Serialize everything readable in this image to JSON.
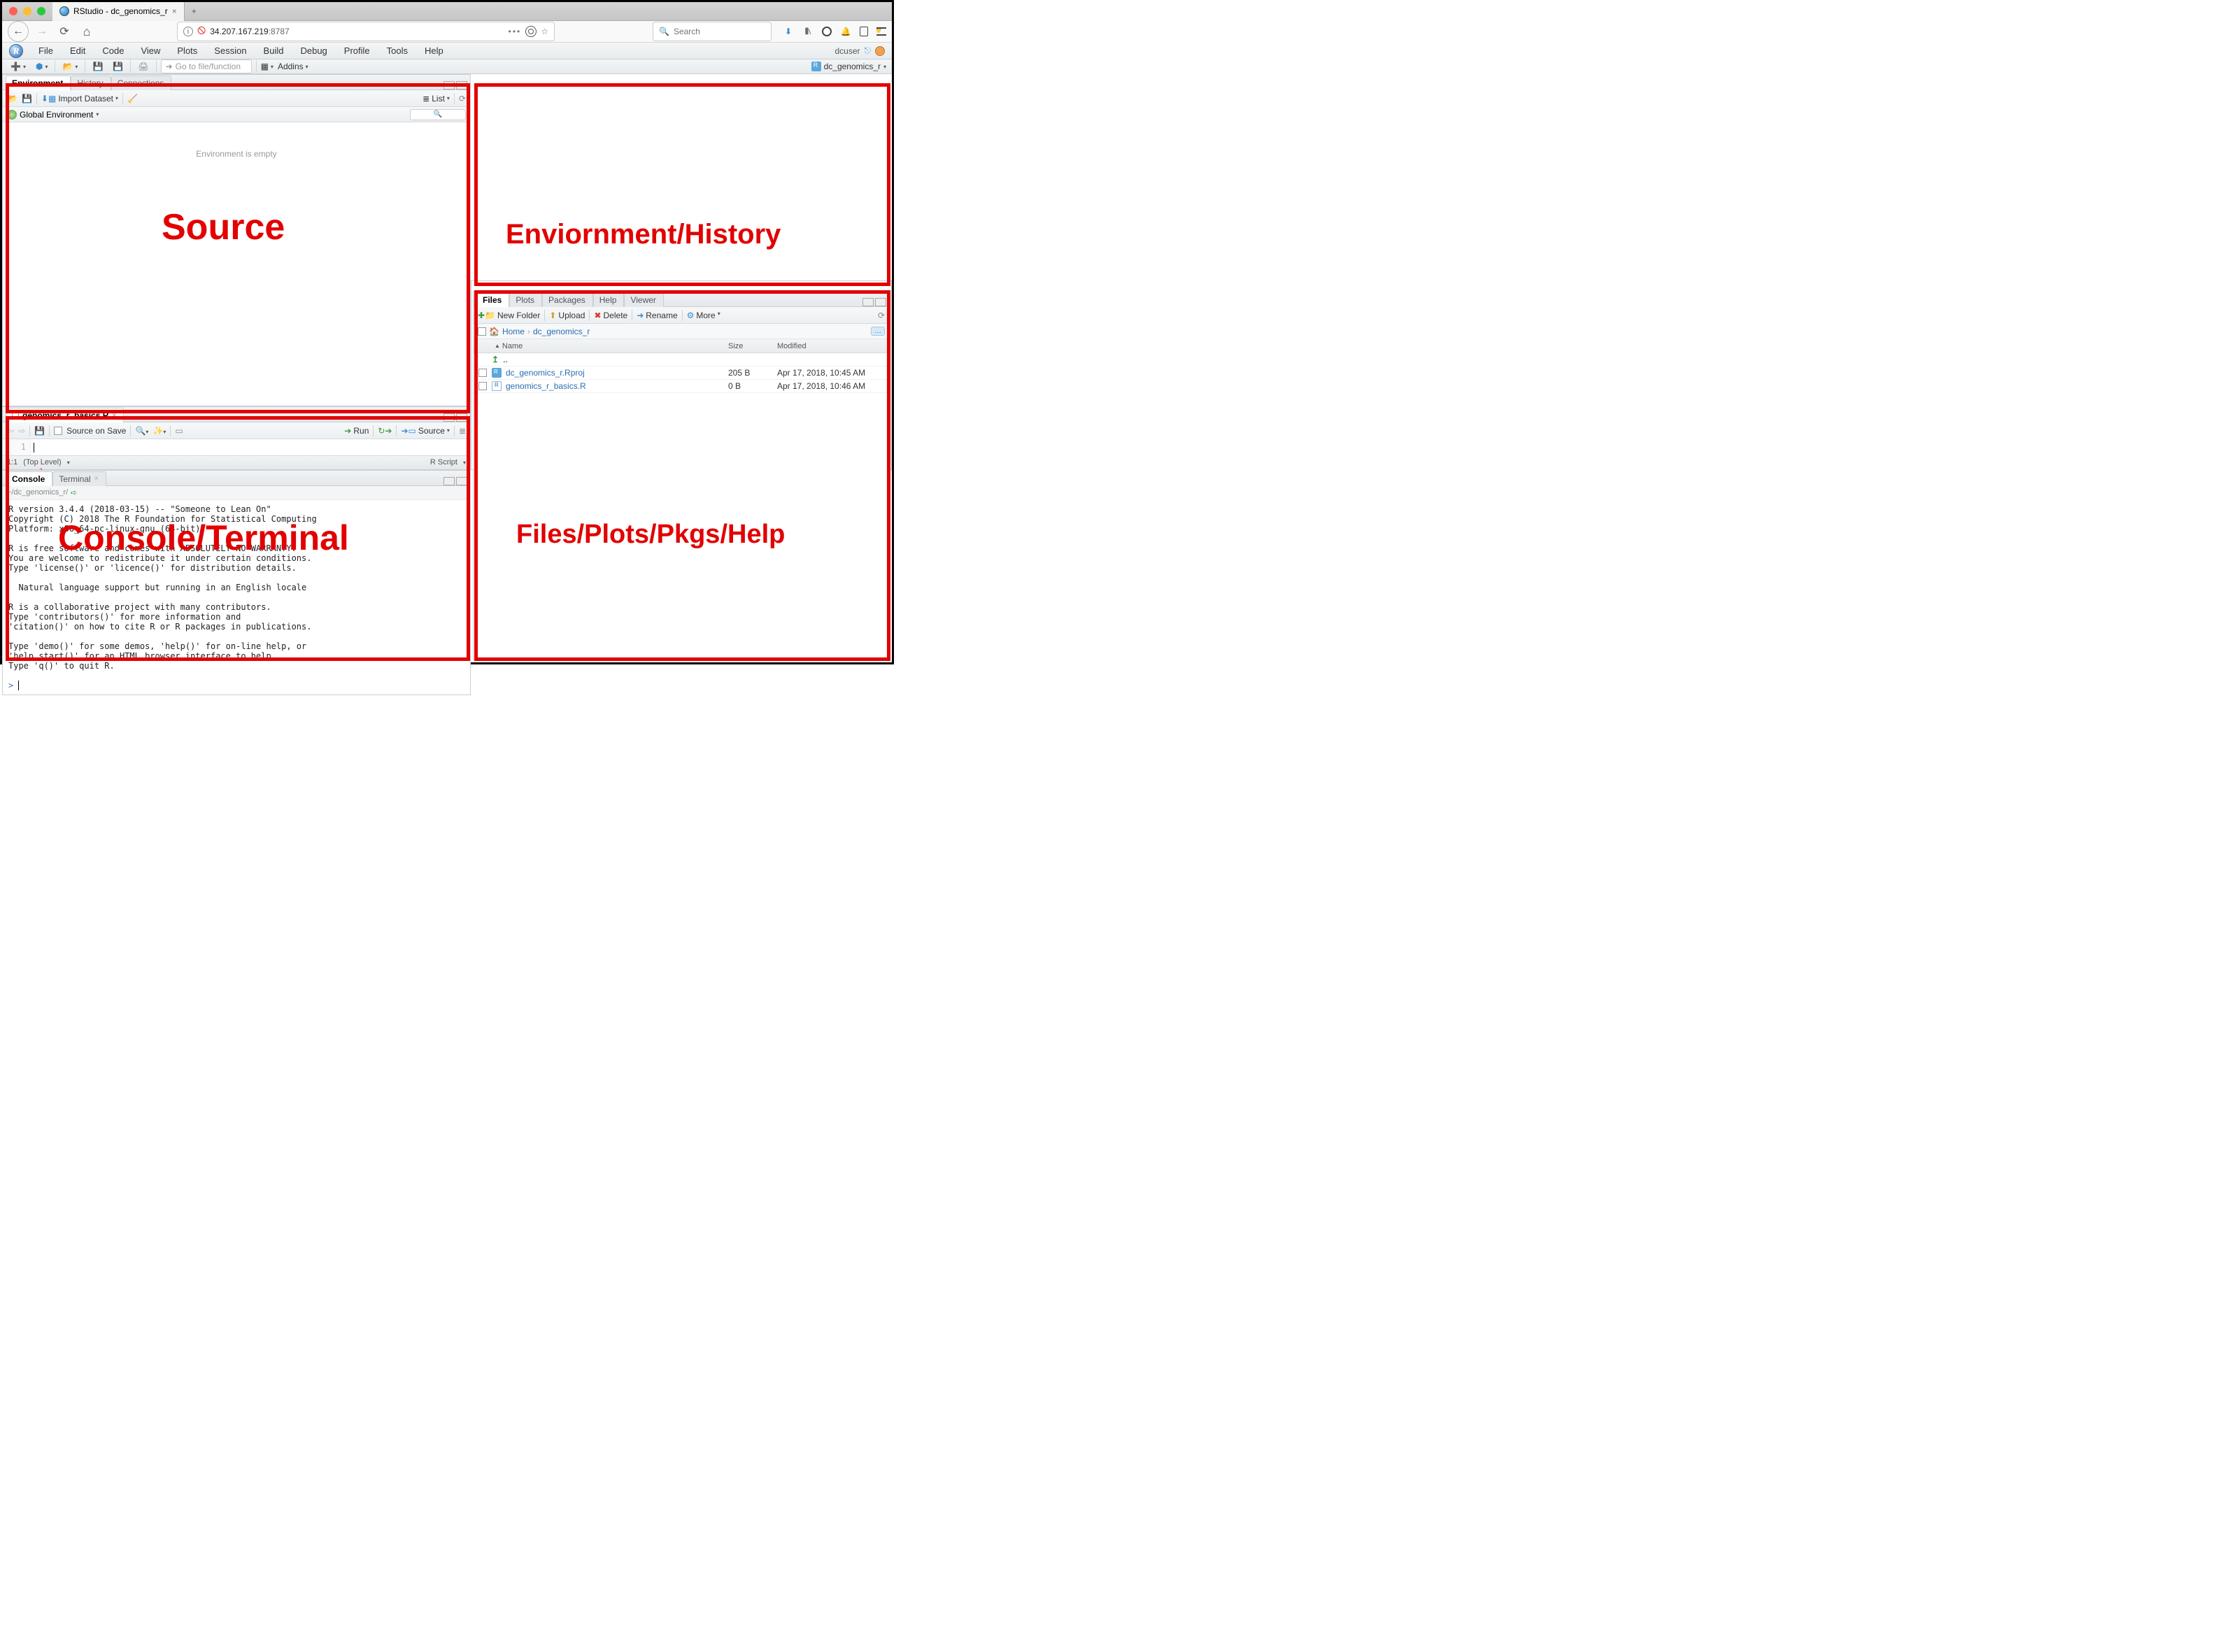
{
  "browser": {
    "tab_title": "RStudio - dc_genomics_r",
    "url_host": "34.207.167.219",
    "url_port": ":8787",
    "search_placeholder": "Search"
  },
  "menubar": {
    "items": [
      "File",
      "Edit",
      "Code",
      "View",
      "Plots",
      "Session",
      "Build",
      "Debug",
      "Profile",
      "Tools",
      "Help"
    ],
    "user": "dcuser",
    "project": "dc_genomics_r"
  },
  "toolbar": {
    "goto_placeholder": "Go to file/function",
    "addins_label": "Addins"
  },
  "source": {
    "tab": "genomics_r_basics.R",
    "source_on_save": "Source on Save",
    "run": "Run",
    "source_btn": "Source",
    "line_number": "1",
    "status_pos": "1:1",
    "status_scope": "(Top Level)",
    "status_lang": "R Script"
  },
  "environment": {
    "tabs": [
      "Environment",
      "History",
      "Connections"
    ],
    "import_label": "Import Dataset",
    "list_label": "List",
    "scope_label": "Global Environment",
    "empty_msg": "Environment is empty"
  },
  "console": {
    "tabs": [
      "Console",
      "Terminal"
    ],
    "path": "~/dc_genomics_r/",
    "text": "R version 3.4.4 (2018-03-15) -- \"Someone to Lean On\"\nCopyright (C) 2018 The R Foundation for Statistical Computing\nPlatform: x86_64-pc-linux-gnu (64-bit)\n\nR is free software and comes with ABSOLUTELY NO WARRANTY.\nYou are welcome to redistribute it under certain conditions.\nType 'license()' or 'licence()' for distribution details.\n\n  Natural language support but running in an English locale\n\nR is a collaborative project with many contributors.\nType 'contributors()' for more information and\n'citation()' on how to cite R or R packages in publications.\n\nType 'demo()' for some demos, 'help()' for on-line help, or\n'help.start()' for an HTML browser interface to help.\nType 'q()' to quit R.\n",
    "prompt": ">"
  },
  "files": {
    "tabs": [
      "Files",
      "Plots",
      "Packages",
      "Help",
      "Viewer"
    ],
    "new_folder": "New Folder",
    "upload": "Upload",
    "delete": "Delete",
    "rename": "Rename",
    "more": "More",
    "breadcrumb_home": "Home",
    "breadcrumb_dir": "dc_genomics_r",
    "header_name": "Name",
    "header_size": "Size",
    "header_modified": "Modified",
    "updir": "..",
    "rows": [
      {
        "name": "dc_genomics_r.Rproj",
        "size": "205 B",
        "modified": "Apr 17, 2018, 10:45 AM",
        "type": "rproj"
      },
      {
        "name": "genomics_r_basics.R",
        "size": "0 B",
        "modified": "Apr 17, 2018, 10:46 AM",
        "type": "rfile"
      }
    ]
  },
  "annotations": {
    "source": "Source",
    "envhist": "Enviornment/History",
    "console": "Console/Terminal",
    "files": "Files/Plots/Pkgs/Help",
    "bracket": "}"
  }
}
